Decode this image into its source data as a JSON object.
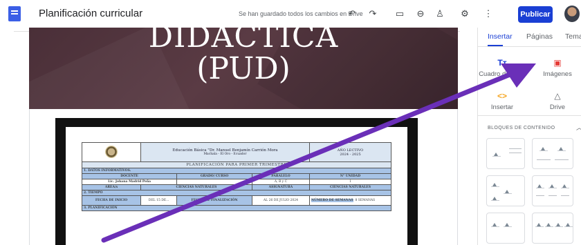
{
  "app": {
    "title": "Planificación curricular",
    "save_status": "Se han guardado todos los cambios en Drive",
    "publish_label": "Publicar"
  },
  "toolbar_icons": [
    "undo-icon",
    "redo-icon",
    "preview-icon",
    "link-icon",
    "add-person-icon",
    "settings-icon",
    "more-vert-icon"
  ],
  "hero": {
    "line1": "DIDÁCTICA",
    "line2": "(PUD)"
  },
  "document": {
    "school": "Educación Básica \"Dr. Manuel Benjamín Carrión Mora",
    "location": "Machala  -  El Oro  -  Ecuador",
    "year_label": "AÑO LECTIVO",
    "year_value": "2024 - 2025",
    "plan_title": "PLANIFICACIÓN  PARA  PRIMER TRIMESTRE",
    "section1": "1.   DATOS INFORMATIVOS.",
    "col_docente": "DOCENTE",
    "col_grado": "GRADO/ CURSO",
    "col_paralelo": "PARALELO",
    "col_unidad": "N° UNIDAD",
    "docente_name": "Lic. Johana Madrid Peña",
    "paralelo_value": "A, B y C",
    "unidad_value": "1",
    "area_label": "AREA/s",
    "area_value": "CIENCIAS NATURALES",
    "asignatura_label": "ASIGNATURA",
    "asignatura_value": "CIENCIAS NATURALES",
    "section2": "2.   TIEMPO",
    "fecha_inicio_label": "FECHA DE INICIO",
    "fecha_inicio_value": "DEL 15 DE...",
    "fecha_fin_label": "FECHA DE FINALIZACIÓN",
    "fecha_fin_value": "AL 26 DE JULIO 2024",
    "semanas_label": "NÚMERO DE SEMANAS",
    "semanas_value": "8 SEMANAS",
    "section3": "3.   PLANIFICACIÓN"
  },
  "panel": {
    "tabs": [
      "Insertar",
      "Páginas",
      "Temas"
    ],
    "active_tab": "Insertar",
    "tools": [
      {
        "label": "Cuadro de texto",
        "icon": "text-box-icon",
        "glyph": "Tт",
        "color": "#1a3fd4"
      },
      {
        "label": "Imágenes",
        "icon": "image-icon",
        "glyph": "▣",
        "color": "#e53935"
      },
      {
        "label": "Insertar",
        "icon": "embed-icon",
        "glyph": "<>",
        "color": "#f5a623"
      },
      {
        "label": "Drive",
        "icon": "drive-icon",
        "glyph": "△",
        "color": "#5f6368"
      }
    ],
    "blocks_heading": "BLOQUES DE CONTENIDO"
  },
  "colors": {
    "accent": "#1a3fd4",
    "hero_bg": "#4a2f38",
    "arrow": "#6a2fb8"
  }
}
